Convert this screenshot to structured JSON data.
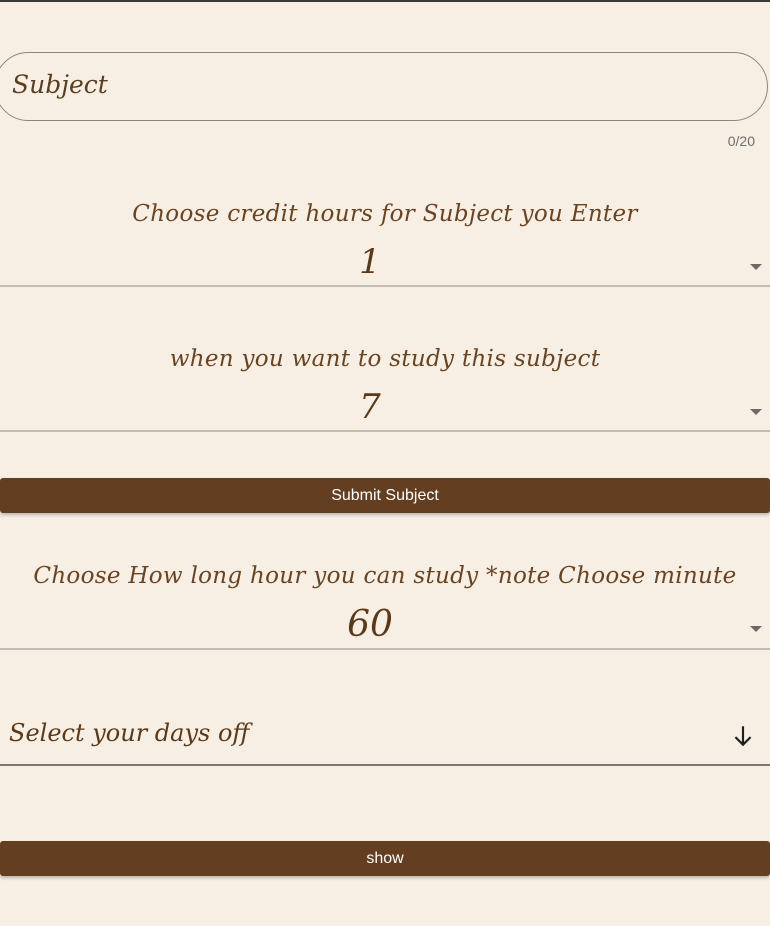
{
  "subject": {
    "placeholder": "Subject",
    "counter": "0/20"
  },
  "credit_hours": {
    "label": "Choose credit hours for Subject you Enter",
    "selected": "1"
  },
  "study_time": {
    "label": "when you want to study this subject",
    "selected": "7"
  },
  "submit_button": {
    "label": "Submit Subject"
  },
  "study_length": {
    "label": "Choose How long hour you can study *note Choose minute",
    "selected": "60"
  },
  "days_off": {
    "label": "Select your days off",
    "icon": "arrow-down-icon"
  },
  "show_button": {
    "label": "show"
  },
  "colors": {
    "background": "#f8efe4",
    "button": "#633e20",
    "label_text": "#6a4321"
  }
}
